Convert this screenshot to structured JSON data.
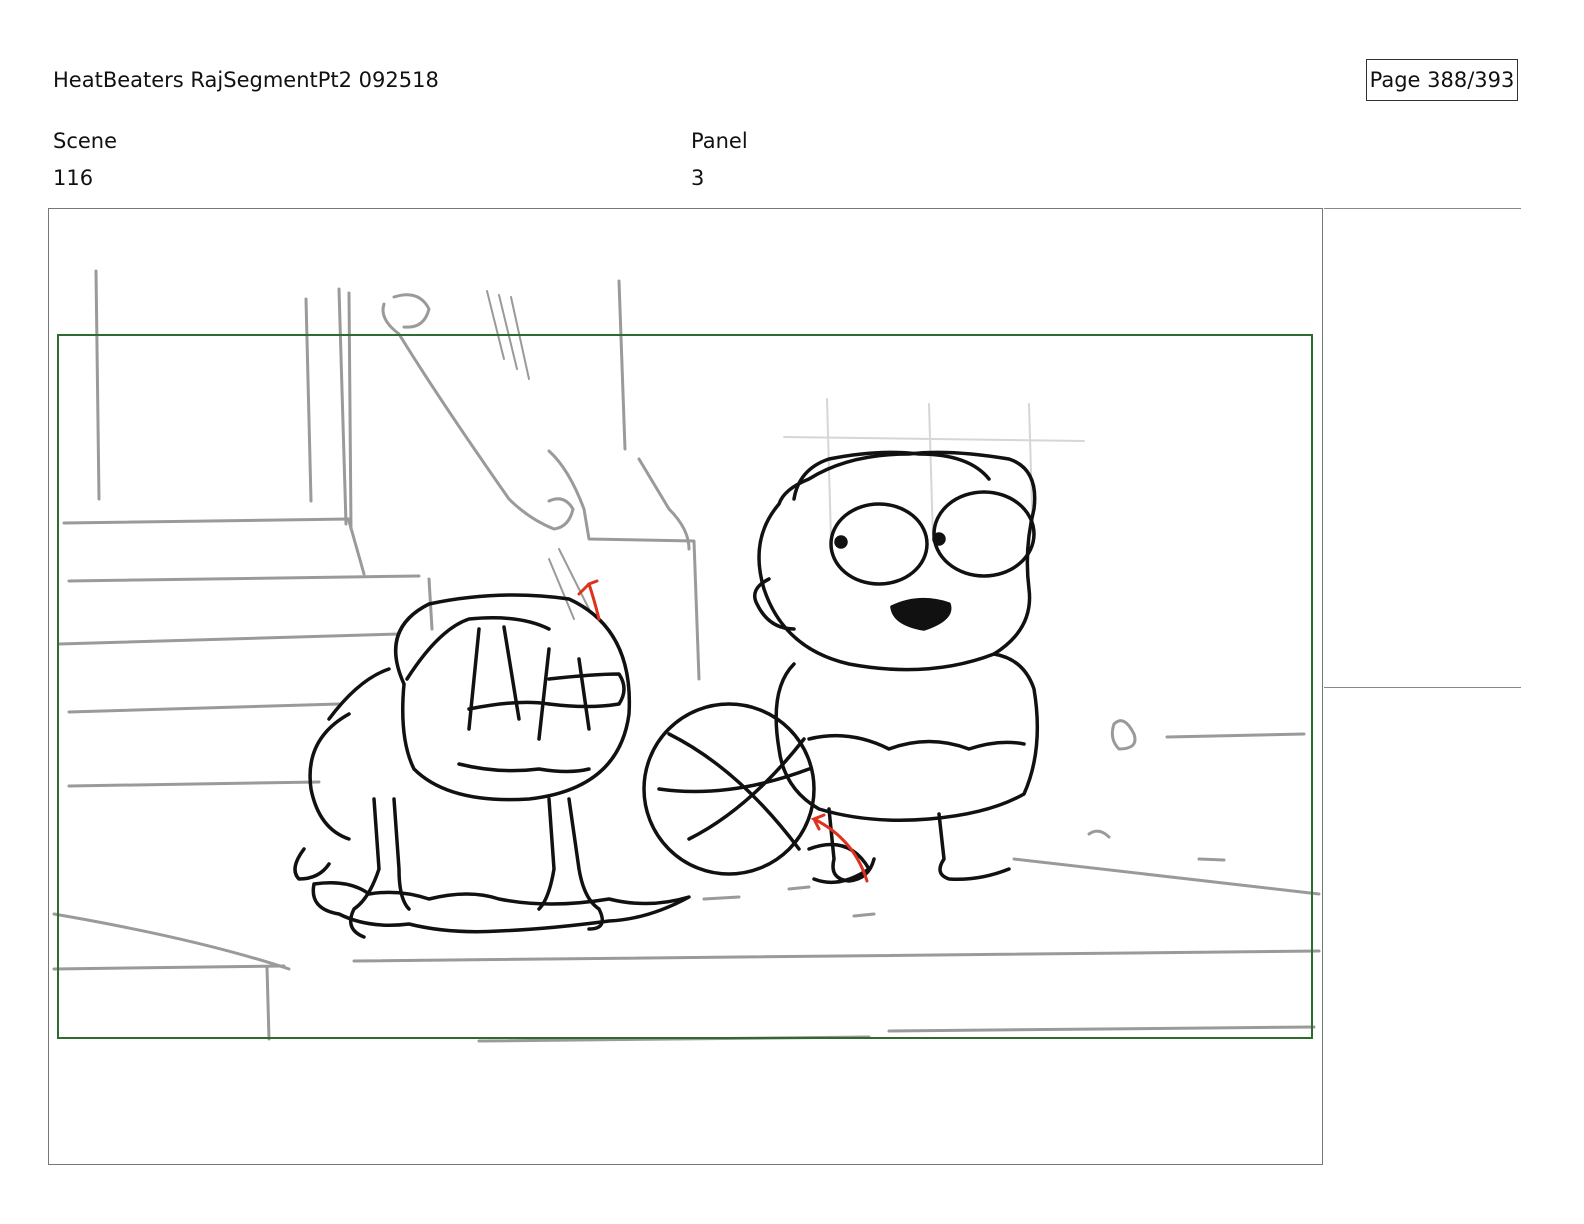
{
  "header": {
    "title": "HeatBeaters RajSegmentPt2 092518",
    "page": "Page 388/393"
  },
  "fields": {
    "scene_label": "Scene",
    "scene_value": "116",
    "panel_label": "Panel",
    "panel_value": "3"
  },
  "colors": {
    "safe_frame": "#2e6b2e",
    "sketch": "#111111",
    "background_sketch": "#999999",
    "motion_arrows": "#e0301e"
  }
}
